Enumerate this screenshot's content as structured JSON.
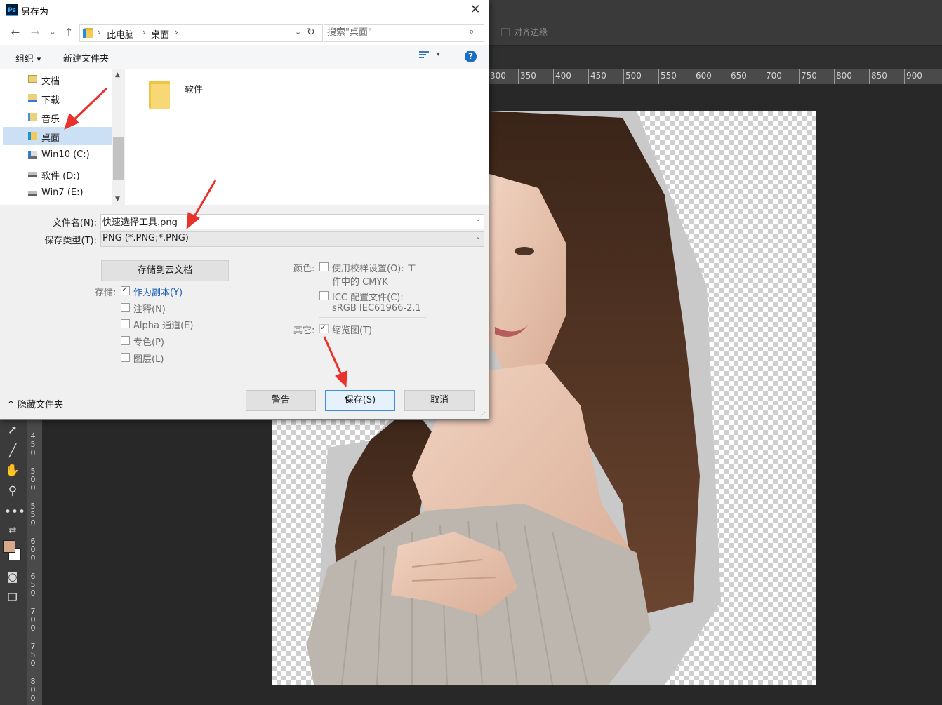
{
  "dialog": {
    "title": "另存为",
    "app_icon_text": "Ps",
    "close_glyph": "✕",
    "nav": {
      "back": "←",
      "forward": "→",
      "recent": "⌄",
      "up": "↑"
    },
    "address": {
      "segments": [
        "此电脑",
        "桌面"
      ],
      "separator": "›",
      "dropdown": "⌄",
      "refresh": "↻"
    },
    "search": {
      "placeholder": "搜索\"桌面\"",
      "icon": "⌕"
    },
    "commands": {
      "organize": "组织 ▾",
      "new_folder": "新建文件夹",
      "view_dropdown": "▾",
      "help": "?"
    },
    "nav_pane": {
      "items": [
        {
          "label": "文档",
          "icon": "documents-icon",
          "selected": false
        },
        {
          "label": "下载",
          "icon": "downloads-icon",
          "selected": false
        },
        {
          "label": "音乐",
          "icon": "music-icon",
          "selected": false
        },
        {
          "label": "桌面",
          "icon": "desktop-icon",
          "selected": true
        },
        {
          "label": "Win10 (C:)",
          "icon": "system-drive-icon",
          "selected": false
        },
        {
          "label": "软件 (D:)",
          "icon": "drive-icon",
          "selected": false
        },
        {
          "label": "Win7 (E:)",
          "icon": "drive-icon",
          "selected": false
        }
      ],
      "scroll_up": "▲",
      "scroll_down": "▼"
    },
    "files": [
      {
        "name": "软件",
        "type": "folder"
      }
    ],
    "filename": {
      "label": "文件名(N):",
      "value": "快速选择工具.png"
    },
    "filetype": {
      "label": "保存类型(T):",
      "value": "PNG (*.PNG;*.PNG)"
    },
    "combo_dropdown": "⌄",
    "cloud_button": "存储到云文档",
    "save_options": {
      "label": "存储:",
      "as_copy": "作为副本(Y)",
      "annotations": "注释(N)",
      "alpha": "Alpha 通道(E)",
      "spot": "专色(P)",
      "layers": "图层(L)"
    },
    "color_options": {
      "label": "颜色:",
      "proof_line1": "使用校样设置(O):  工",
      "proof_line2": "作中的 CMYK",
      "icc_line1": "ICC 配置文件(C):",
      "icc_line2": "sRGB IEC61966-2.1"
    },
    "other_options": {
      "label": "其它:",
      "thumbnail": "缩览图(T)"
    },
    "hide_folders": "^ 隐藏文件夹",
    "buttons": {
      "warning": "警告",
      "save": "保存(S)",
      "cancel": "取消"
    },
    "resize_grip": "⋰"
  },
  "photoshop": {
    "align_edges": "对齐边缘",
    "ruler_top": [
      "300",
      "350",
      "400",
      "450",
      "500",
      "550",
      "600",
      "650",
      "700",
      "750",
      "800",
      "850",
      "900"
    ],
    "ruler_left": [
      "4\n5\n0",
      "5\n0\n0",
      "5\n5\n0",
      "6\n0\n0",
      "6\n5\n0",
      "7\n0\n0",
      "7\n5\n0",
      "8\n0\n0"
    ],
    "tools": [
      "select-arrow-icon",
      "line-tool-icon",
      "hand-tool-icon",
      "zoom-tool-icon",
      "more-tools-icon",
      "swap-colors-icon",
      "quick-mask-icon",
      "screen-mode-icon"
    ],
    "colors": {
      "foreground": "#d7a88a",
      "background": "#ffffff",
      "accent": "#1a5fb4",
      "annotation_arrow": "#e8322b"
    }
  }
}
